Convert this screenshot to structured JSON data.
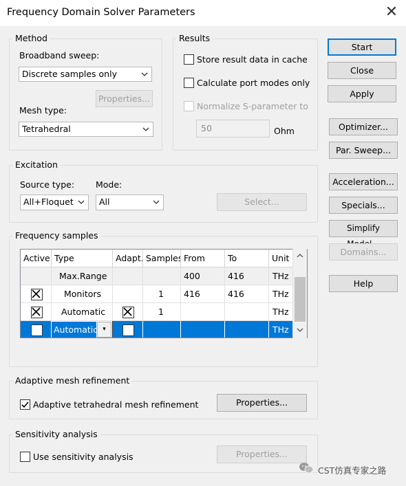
{
  "window": {
    "title": "Frequency Domain Solver Parameters"
  },
  "method": {
    "group_label": "Method",
    "broadband_label": "Broadband sweep:",
    "broadband_value": "Discrete samples only",
    "properties_label": "Properties...",
    "mesh_type_label": "Mesh type:",
    "mesh_type_value": "Tetrahedral"
  },
  "results": {
    "group_label": "Results",
    "store_cache_label": "Store result data in cache",
    "store_cache_checked": false,
    "port_modes_label": "Calculate port modes only",
    "port_modes_checked": false,
    "normalize_label": "Normalize S-parameter to",
    "normalize_checked": false,
    "impedance_value": "50",
    "impedance_unit": "Ohm"
  },
  "excitation": {
    "group_label": "Excitation",
    "source_type_label": "Source type:",
    "source_type_value": "All+Floquet",
    "mode_label": "Mode:",
    "mode_value": "All",
    "select_label": "Select..."
  },
  "frequency_samples": {
    "group_label": "Frequency samples",
    "columns": [
      "Active",
      "Type",
      "Adapt.",
      "Samples",
      "From",
      "To",
      "Unit"
    ],
    "rows": [
      {
        "active": "",
        "type": "Max.Range",
        "adapt": "",
        "samples": "",
        "from": "400",
        "to": "416",
        "unit": "THz",
        "active_checked": false,
        "adapt_checked": false,
        "style": "gray"
      },
      {
        "active": "",
        "type": "Monitors",
        "adapt": "",
        "samples": "1",
        "from": "416",
        "to": "416",
        "unit": "THz",
        "active_checked": true,
        "adapt_checked": false,
        "style": "normal"
      },
      {
        "active": "",
        "type": "Automatic",
        "adapt": "",
        "samples": "1",
        "from": "",
        "to": "",
        "unit": "THz",
        "active_checked": true,
        "adapt_checked": true,
        "style": "normal"
      },
      {
        "active": "",
        "type": "Automatic",
        "adapt": "",
        "samples": "",
        "from": "",
        "to": "",
        "unit": "THz",
        "active_checked": false,
        "adapt_checked": false,
        "style": "selected"
      }
    ]
  },
  "adaptive_mesh": {
    "group_label": "Adaptive mesh refinement",
    "checkbox_label": "Adaptive tetrahedral mesh refinement",
    "checked": true,
    "properties_label": "Properties..."
  },
  "sensitivity": {
    "group_label": "Sensitivity analysis",
    "checkbox_label": "Use sensitivity analysis",
    "checked": false,
    "properties_label": "Properties..."
  },
  "side_buttons": {
    "start": "Start",
    "close": "Close",
    "apply": "Apply",
    "optimizer": "Optimizer...",
    "par_sweep": "Par. Sweep...",
    "acceleration": "Acceleration...",
    "specials": "Specials...",
    "simplify_model": "Simplify Model...",
    "domains": "Domains...",
    "help": "Help"
  },
  "watermark": {
    "text": "CST仿真专家之路"
  },
  "colors": {
    "accent": "#0078d7",
    "selection": "#0078d7",
    "background": "#f0f0f0"
  }
}
